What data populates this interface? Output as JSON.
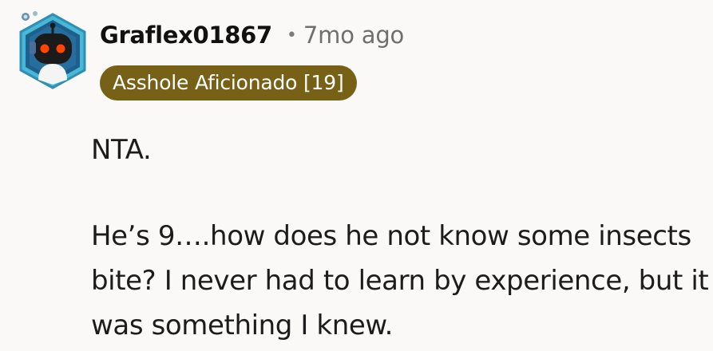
{
  "comment": {
    "username": "Graflex01867",
    "separator": "•",
    "timestamp": "7mo ago",
    "flair": "Asshole Aficionado [19]",
    "paragraphs": [
      "NTA.",
      "He’s 9….how does he not know some insects bite? I never had to learn by experience, but it was something I knew."
    ]
  },
  "colors": {
    "background": "#fbf9f7",
    "flair_background": "#766117",
    "flair_text": "#ffffff",
    "username": "#111111",
    "meta": "#6f6f6f",
    "avatar_frame": "#3aa8c9",
    "avatar_eyes": "#ff4500"
  },
  "icons": {
    "avatar": "snoo-robot-avatar"
  }
}
